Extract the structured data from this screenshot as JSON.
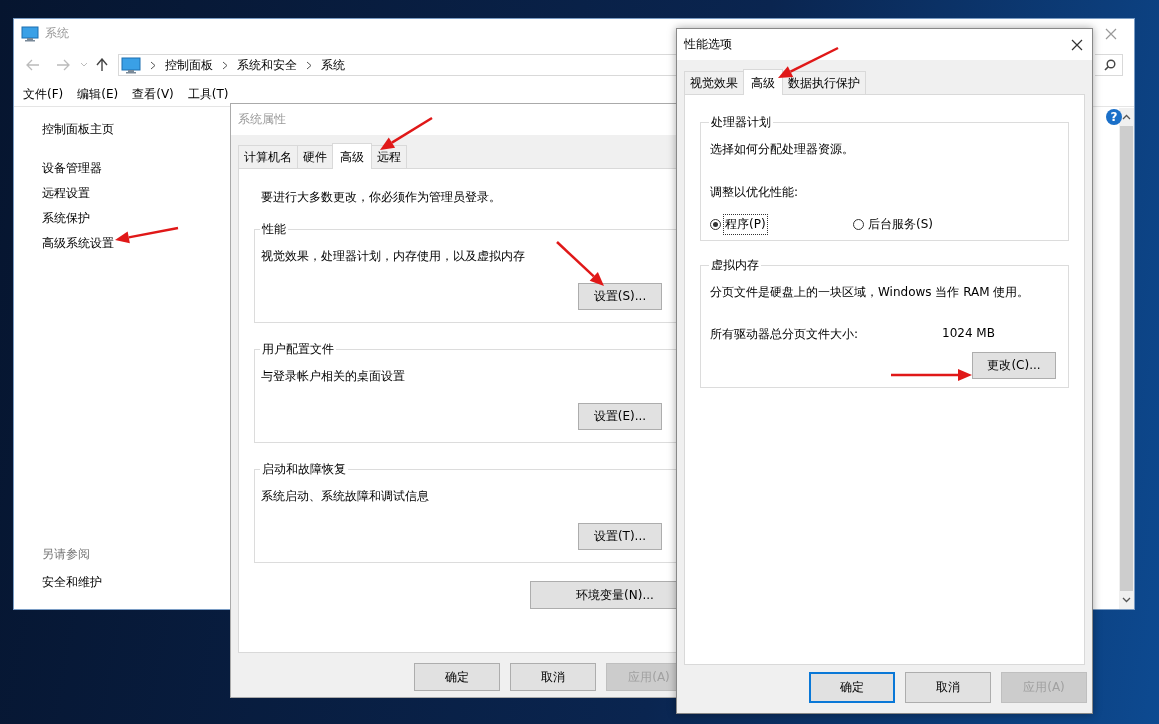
{
  "system_window": {
    "title": "系统",
    "breadcrumbs": [
      "控制面板",
      "系统和安全",
      "系统"
    ],
    "menu": [
      "文件(F)",
      "编辑(E)",
      "查看(V)",
      "工具(T)"
    ],
    "sidebar": {
      "home": "控制面板主页",
      "items": [
        "设备管理器",
        "远程设置",
        "系统保护",
        "高级系统设置"
      ],
      "see_also": {
        "heading": "另请参阅",
        "items": [
          "安全和维护"
        ]
      }
    },
    "help_icon": "?"
  },
  "system_properties": {
    "title": "系统属性",
    "tabs": [
      {
        "label": "计算机名",
        "selected": false
      },
      {
        "label": "硬件",
        "selected": false
      },
      {
        "label": "高级",
        "selected": true
      },
      {
        "label": "远程",
        "selected": false
      }
    ],
    "notice": "要进行大多数更改，你必须作为管理员登录。",
    "groups": [
      {
        "title": "性能",
        "description": "视觉效果，处理器计划，内存使用，以及虚拟内存",
        "button": "设置(S)..."
      },
      {
        "title": "用户配置文件",
        "description": "与登录帐户相关的桌面设置",
        "button": "设置(E)..."
      },
      {
        "title": "启动和故障恢复",
        "description": "系统启动、系统故障和调试信息",
        "button": "设置(T)..."
      }
    ],
    "env_button": "环境变量(N)...",
    "buttons": [
      {
        "label": "确定",
        "disabled": false,
        "default": false
      },
      {
        "label": "取消",
        "disabled": false,
        "default": false
      },
      {
        "label": "应用(A)",
        "disabled": true,
        "default": false
      }
    ]
  },
  "performance_options": {
    "title": "性能选项",
    "tabs": [
      {
        "label": "视觉效果",
        "selected": false
      },
      {
        "label": "高级",
        "selected": true
      },
      {
        "label": "数据执行保护",
        "selected": false
      }
    ],
    "processor": {
      "title": "处理器计划",
      "description": "选择如何分配处理器资源。",
      "prompt": "调整以优化性能:",
      "options": [
        {
          "label": "程序(P)",
          "selected": true
        },
        {
          "label": "后台服务(S)",
          "selected": false
        }
      ]
    },
    "virtual_memory": {
      "title": "虚拟内存",
      "description": "分页文件是硬盘上的一块区域，Windows 当作 RAM 使用。",
      "total_label": "所有驱动器总分页文件大小:",
      "total_value": "1024 MB",
      "button": "更改(C)..."
    },
    "buttons": [
      {
        "label": "确定",
        "disabled": false,
        "default": true
      },
      {
        "label": "取消",
        "disabled": false,
        "default": false
      },
      {
        "label": "应用(A)",
        "disabled": true,
        "default": false
      }
    ]
  }
}
